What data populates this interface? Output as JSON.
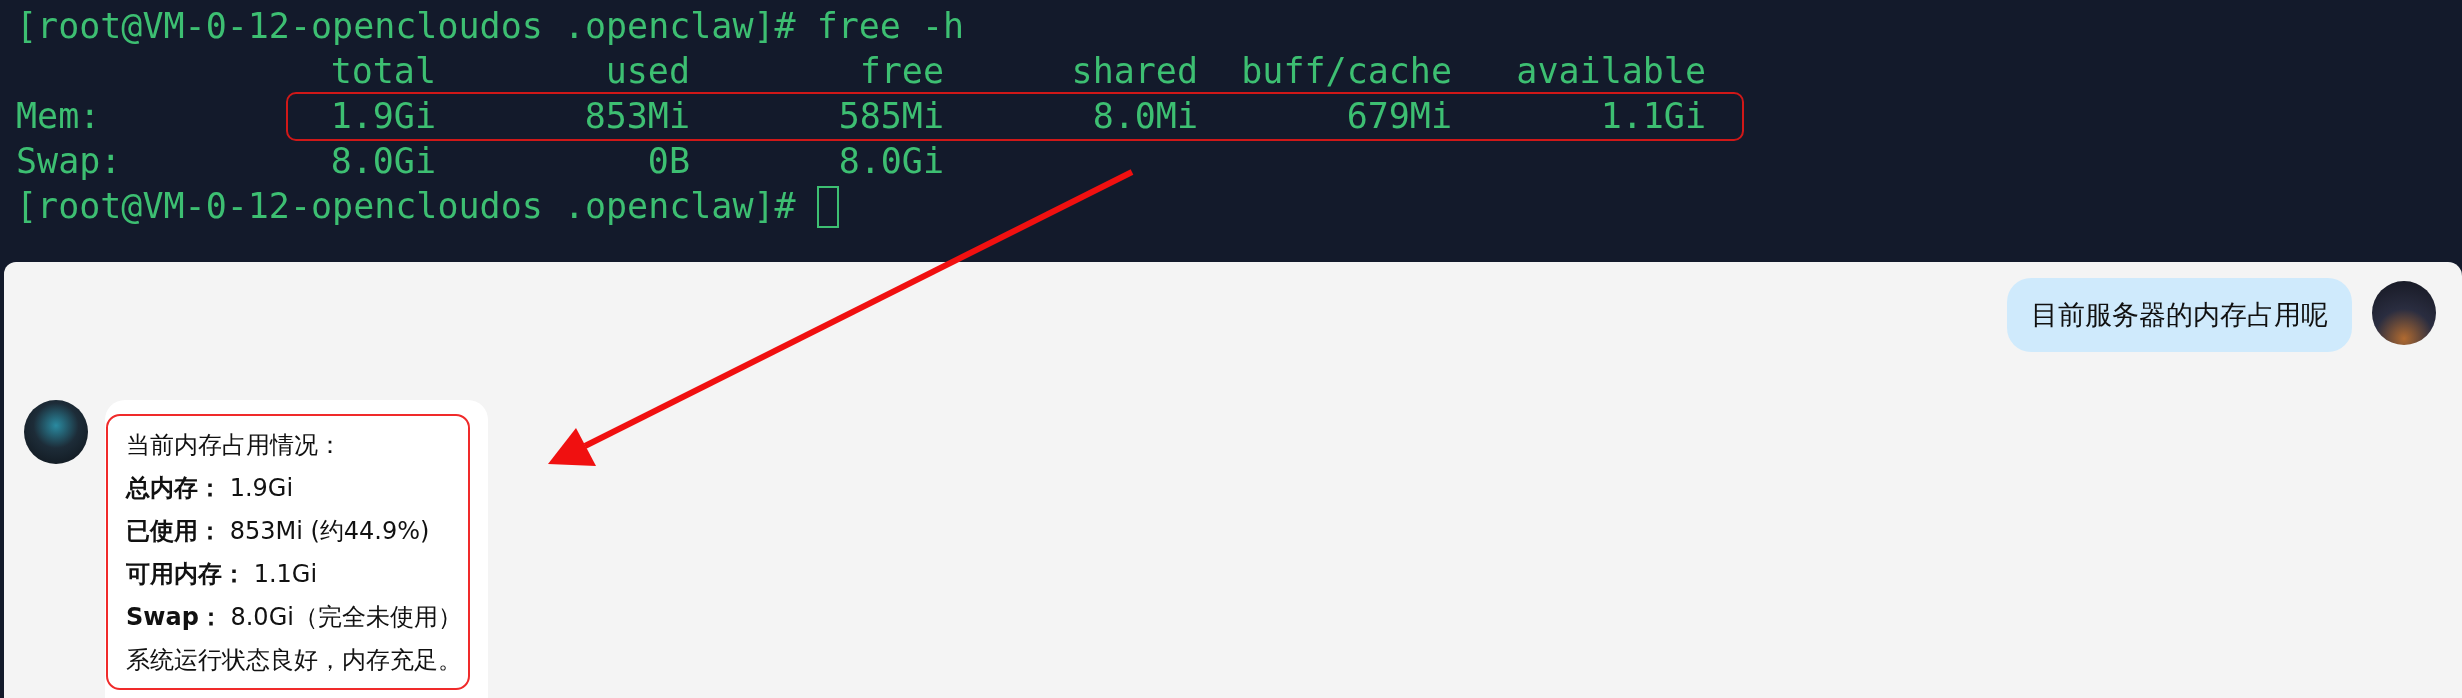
{
  "terminal": {
    "prompt": "[root@VM-0-12-opencloudos .openclaw]#",
    "command": "free -h",
    "columns": [
      "total",
      "used",
      "free",
      "shared",
      "buff/cache",
      "available"
    ],
    "rows": [
      {
        "label": "Mem:",
        "cells": [
          "1.9Gi",
          "853Mi",
          "585Mi",
          "8.0Mi",
          "679Mi",
          "1.1Gi"
        ],
        "highlighted": true
      },
      {
        "label": "Swap:",
        "cells": [
          "8.0Gi",
          "0B",
          "8.0Gi"
        ],
        "highlighted": false
      }
    ],
    "final_prompt": "[root@VM-0-12-opencloudos .openclaw]#",
    "cursor": true
  },
  "chat": {
    "messages": [
      {
        "kind": "user",
        "text": "目前服务器的内存占用呢"
      },
      {
        "kind": "assistant",
        "highlighted": true,
        "lines": [
          "当前内存占用情况：",
          "**总内存：** 1.9Gi",
          "**已使用：** 853Mi (约44.9%)",
          "**可用内存：** 1.1Gi",
          "**Swap：** 8.0Gi（完全未使用）",
          "系统运行状态良好，内存充足。"
        ]
      }
    ]
  }
}
